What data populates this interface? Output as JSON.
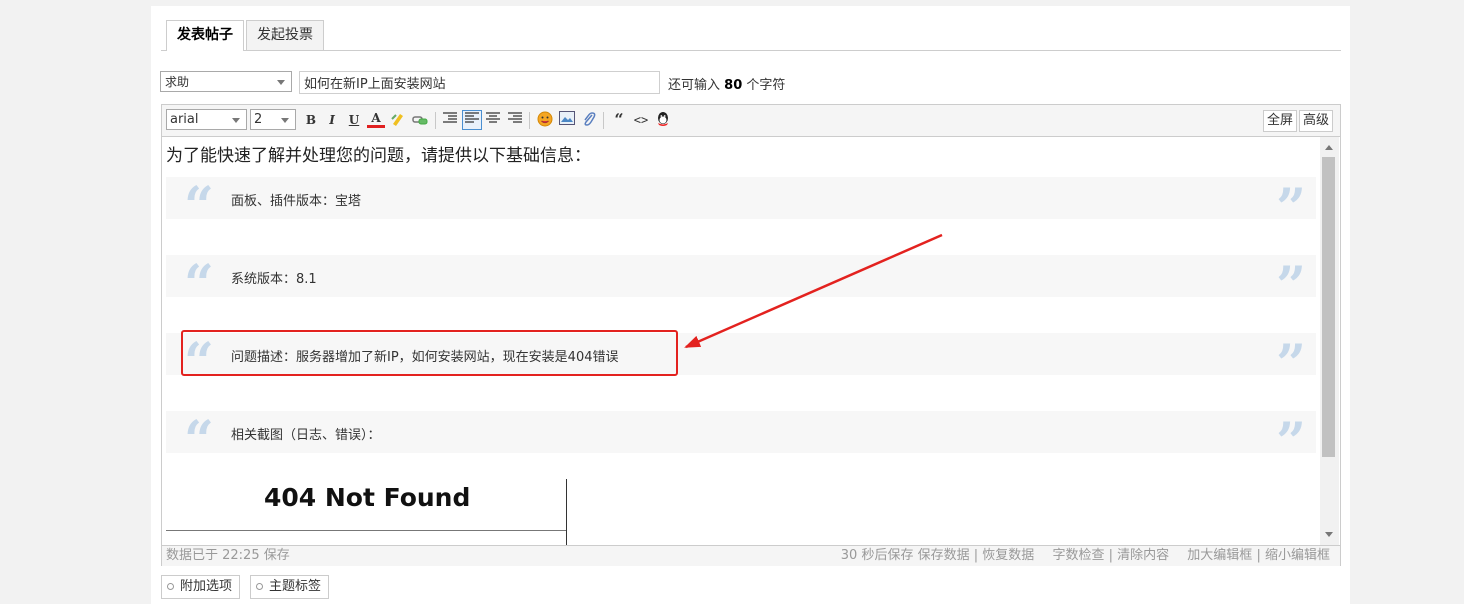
{
  "tabs": [
    {
      "label": "发表帖子",
      "active": true
    },
    {
      "label": "发起投票",
      "active": false
    }
  ],
  "subject": {
    "type_selected": "求助",
    "title_value": "如何在新IP上面安装网站",
    "hint_prefix": "还可输入",
    "hint_count": "80",
    "hint_suffix": "个字符"
  },
  "toolbar": {
    "font_value": "arial",
    "size_value": "2",
    "buttons": {
      "bold": "B",
      "italic": "I",
      "underline": "U",
      "forecolor": "A",
      "quote": "“",
      "code": "<>"
    },
    "fullscreen_label": "全屏",
    "advanced_label": "高级"
  },
  "content": {
    "intro": "为了能快速了解并处理您的问题，请提供以下基础信息：",
    "quotes": [
      "面板、插件版本：宝塔",
      "系统版本：8.1",
      "问题描述：服务器增加了新IP，如何安装网站，现在安装是404错误",
      "相关截图（日志、错误）："
    ],
    "quote_open": "“",
    "quote_close": "”",
    "screenshot_title": "404 Not Found"
  },
  "statusbar": {
    "left": "数据已于 22:25 保存",
    "autosave": "30 秒后保存",
    "save": "保存数据",
    "restore": "恢复数据",
    "wordcheck": "字数检查",
    "clear": "清除内容",
    "enlarge": "加大编辑框",
    "shrink": "缩小编辑框",
    "sep": "|"
  },
  "bottom": {
    "attach_label": "附加选项",
    "tags_label": "主题标签"
  },
  "colors": {
    "annotation_red": "#e3221f",
    "quote_mark": "#c6d8ea",
    "selected_btn_border": "#4a8fd1"
  }
}
